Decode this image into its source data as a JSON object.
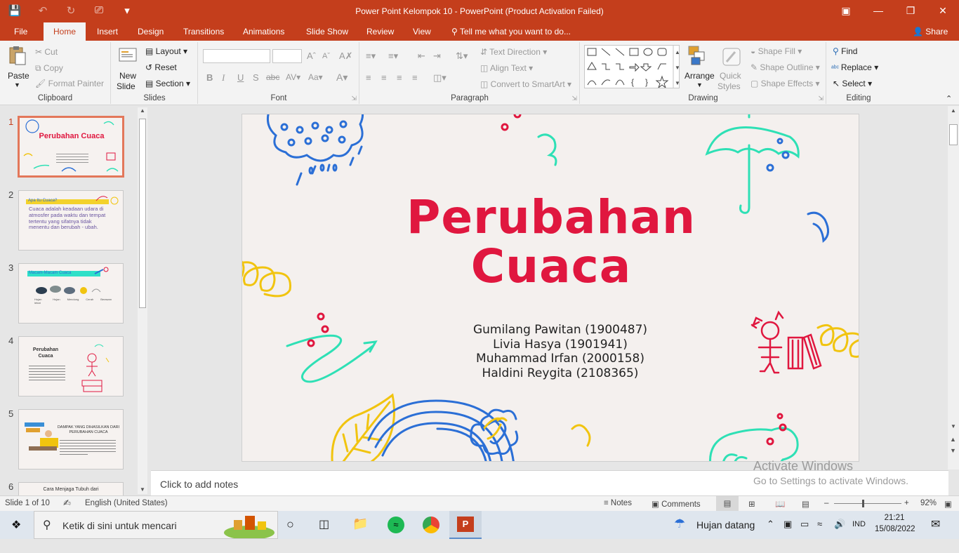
{
  "titlebar": {
    "title": "Power Point Kelompok 10  -  PowerPoint (Product Activation Failed)",
    "colors": {
      "accent": "#c43e1c"
    }
  },
  "tabs": [
    {
      "label": "File"
    },
    {
      "label": "Home"
    },
    {
      "label": "Insert"
    },
    {
      "label": "Design"
    },
    {
      "label": "Transitions"
    },
    {
      "label": "Animations"
    },
    {
      "label": "Slide Show"
    },
    {
      "label": "Review"
    },
    {
      "label": "View"
    }
  ],
  "tell_me": "Tell me what you want to do...",
  "share": "Share",
  "ribbon": {
    "clipboard": {
      "paste": "Paste",
      "cut": "Cut",
      "copy": "Copy",
      "format_painter": "Format Painter",
      "label": "Clipboard"
    },
    "slides": {
      "new_slide_1": "New",
      "new_slide_2": "Slide",
      "layout": "Layout",
      "reset": "Reset",
      "section": "Section",
      "label": "Slides"
    },
    "font": {
      "label": "Font"
    },
    "paragraph": {
      "text_direction": "Text Direction",
      "align_text": "Align Text",
      "smartart": "Convert to SmartArt",
      "label": "Paragraph"
    },
    "drawing": {
      "arrange": "Arrange",
      "quick_styles_1": "Quick",
      "quick_styles_2": "Styles",
      "shape_fill": "Shape Fill",
      "shape_outline": "Shape Outline",
      "shape_effects": "Shape Effects",
      "label": "Drawing"
    },
    "editing": {
      "find": "Find",
      "replace": "Replace",
      "select": "Select",
      "label": "Editing"
    }
  },
  "thumbnails": [
    {
      "num": "1",
      "title": "Perubahan Cuaca"
    },
    {
      "num": "2",
      "heading": "Apa Itu Cuaca?",
      "body": "Cuaca adalah keadaan udara di atmosfer pada waktu dan tempat tertentu yang sifatnya tidak menentu dan berubah - ubah."
    },
    {
      "num": "3",
      "heading": "Macam-Macam Cuaca"
    },
    {
      "num": "4",
      "heading": "Perubahan Cuaca"
    },
    {
      "num": "5",
      "heading": "DAMPAK YANG DIHASILKAN DARI PERUBAHAN CUACA"
    },
    {
      "num": "6",
      "heading": "Cara Menjaga Tubuh dari"
    }
  ],
  "slide": {
    "title_line1": "Perubahan",
    "title_line2": "Cuaca",
    "authors": [
      "Gumilang Pawitan (1900487)",
      "Livia Hasya (1901941)",
      "Muhammad Irfan (2000158)",
      "Haldini Reygita (2108365)"
    ]
  },
  "notes_placeholder": "Click to add notes",
  "watermark": {
    "line1": "Activate Windows",
    "line2": "Go to Settings to activate Windows."
  },
  "status": {
    "slide_info": "Slide 1 of 10",
    "language": "English (United States)",
    "notes": "Notes",
    "comments": "Comments",
    "zoom": "92%"
  },
  "taskbar": {
    "search_placeholder": "Ketik di sini untuk mencari",
    "weather": "Hujan datang",
    "lang": "IND",
    "time": "21:21",
    "date": "15/08/2022"
  }
}
